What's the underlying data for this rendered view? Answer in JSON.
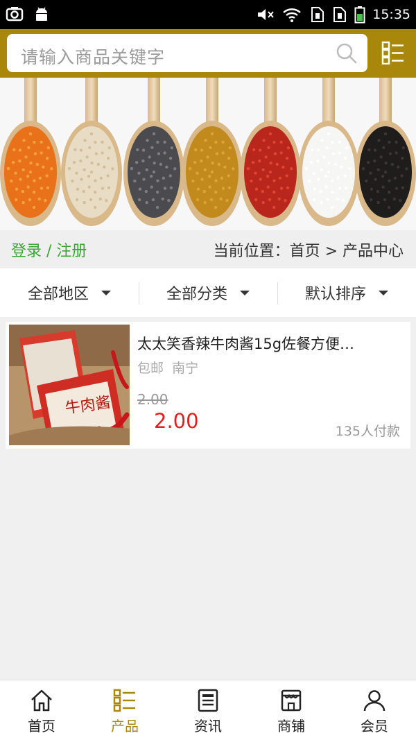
{
  "status_bar": {
    "time": "15:35",
    "icons": [
      "screenshot-icon",
      "android-icon",
      "mute-icon",
      "wifi-icon",
      "sim1-icon",
      "sim2-icon",
      "battery-icon"
    ]
  },
  "search": {
    "placeholder": "请输入商品关键字"
  },
  "breadcrumb": {
    "login_label": "登录 / 注册",
    "path": "当前位置：首页 > 产品中心"
  },
  "filters": [
    {
      "label": "全部地区"
    },
    {
      "label": "全部分类"
    },
    {
      "label": "默认排序"
    }
  ],
  "products": [
    {
      "title": "太太笑香辣牛肉酱15g佐餐方便…",
      "shipping": "包邮",
      "location": "南宁",
      "original_price": "2.00",
      "price": "2.00",
      "sold": "135人付款"
    }
  ],
  "bottom_nav": [
    {
      "label": "首页",
      "icon": "home-icon"
    },
    {
      "label": "产品",
      "icon": "list-icon",
      "active": true
    },
    {
      "label": "资讯",
      "icon": "news-icon"
    },
    {
      "label": "商铺",
      "icon": "shop-icon"
    },
    {
      "label": "会员",
      "icon": "user-icon"
    }
  ],
  "colors": {
    "brand": "#a8870a",
    "login_link": "#3aa733",
    "price": "#e01f1f"
  }
}
